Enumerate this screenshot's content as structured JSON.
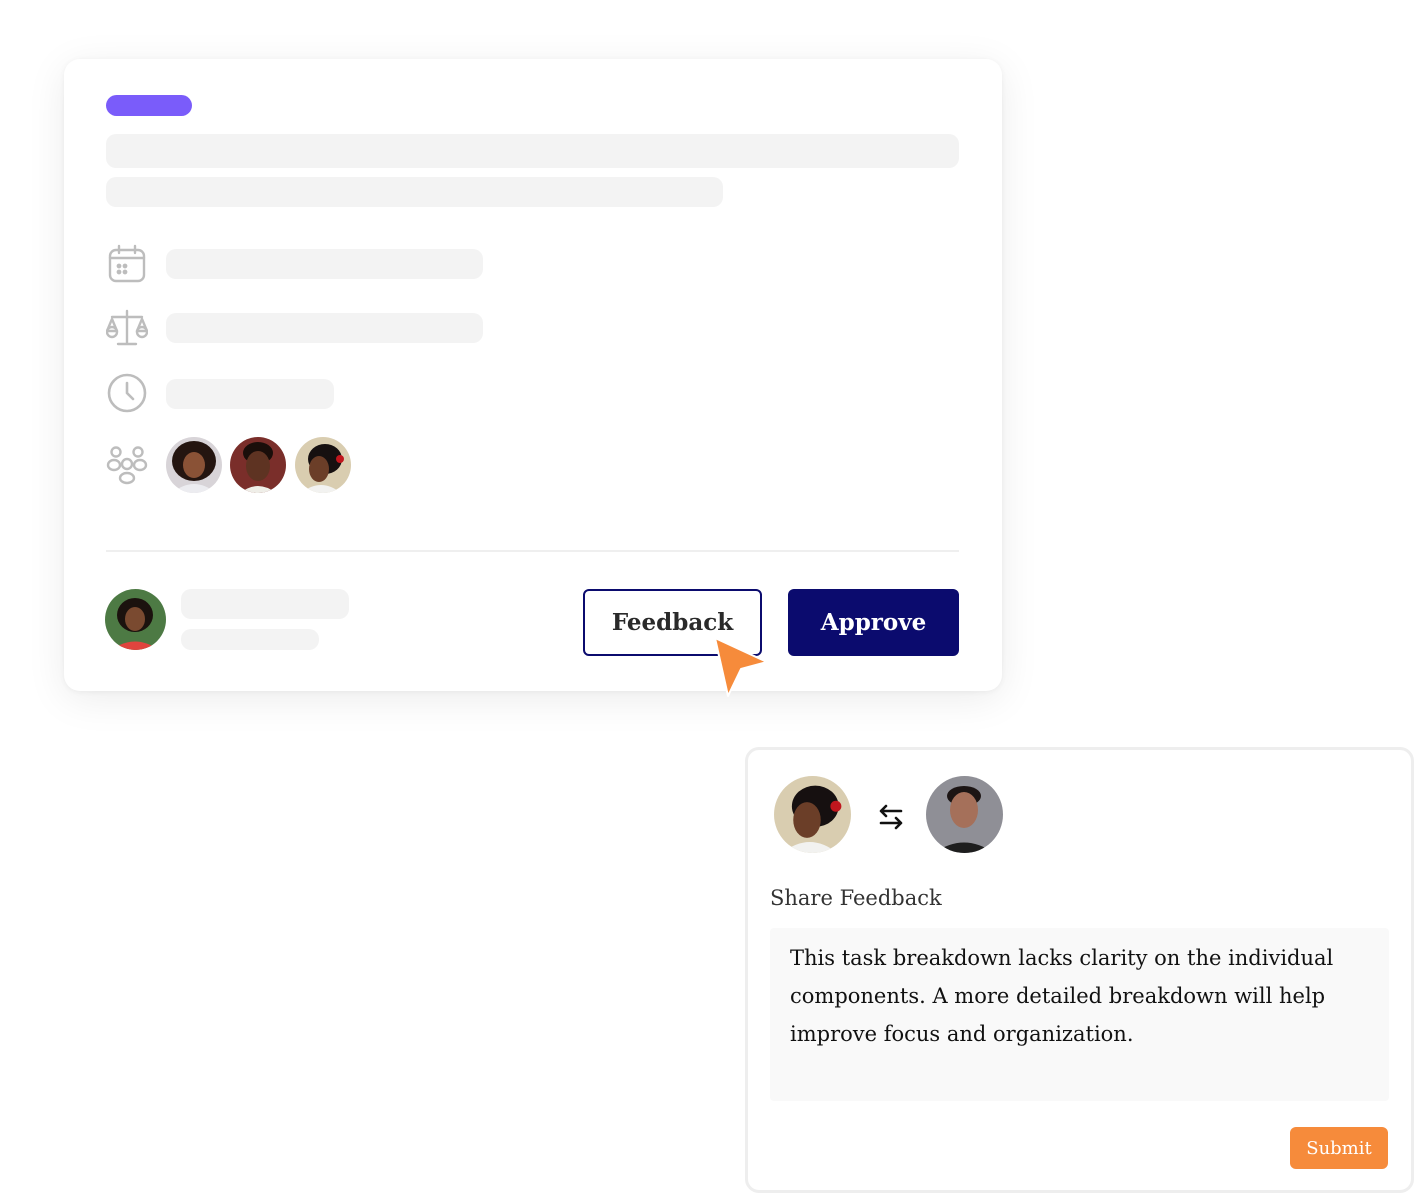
{
  "task_card": {
    "buttons": {
      "feedback_label": "Feedback",
      "approve_label": "Approve"
    },
    "detail_icons": [
      "calendar-icon",
      "scale-icon",
      "clock-icon",
      "team-icon"
    ],
    "assignee_count": 3
  },
  "feedback_panel": {
    "swap_icon": "swap-arrows-icon",
    "label": "Share Feedback",
    "message": "This task breakdown lacks clarity on the individual components. A more detailed breakdown will help improve focus and organization.",
    "submit_label": "Submit"
  },
  "colors": {
    "accent_purple": "#7a5cfa",
    "primary_navy": "#0b0b6e",
    "accent_orange": "#f68b3b",
    "skeleton_gray": "#f3f3f3"
  }
}
